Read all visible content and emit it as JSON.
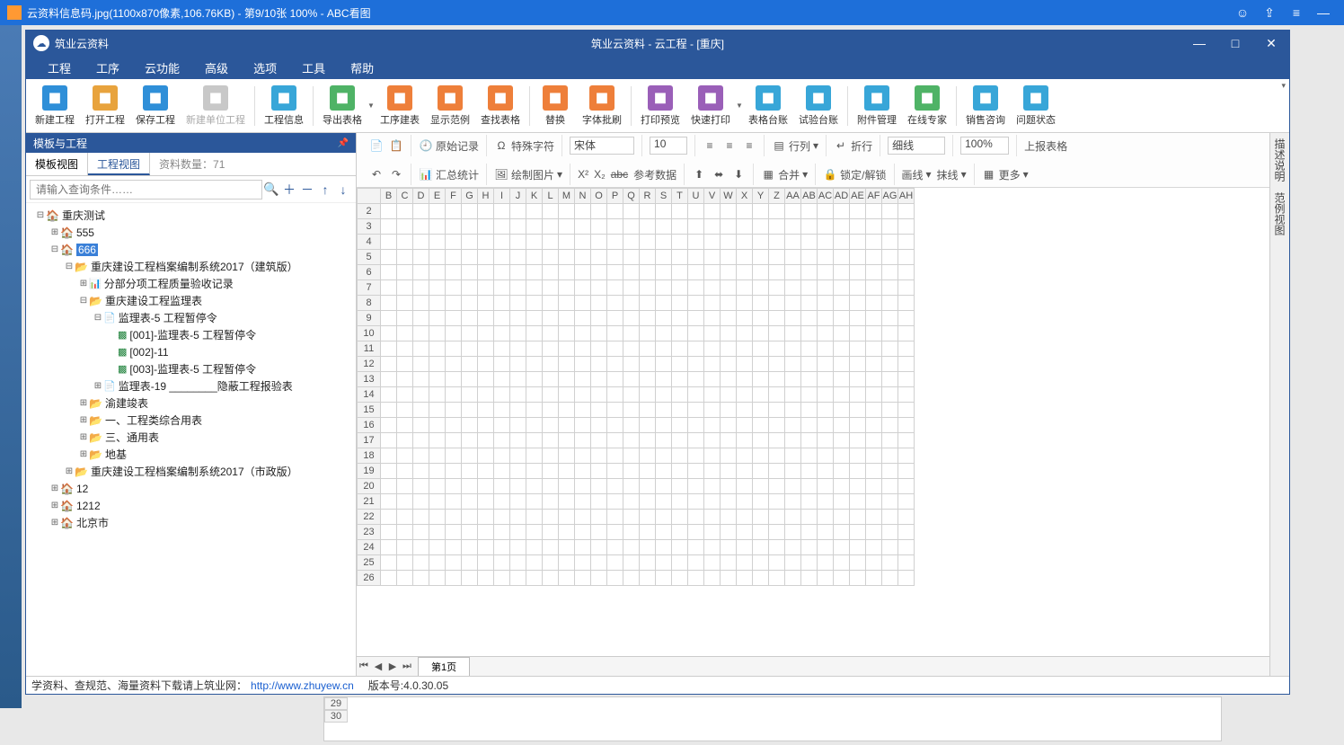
{
  "viewer": {
    "title": "云资料信息码.jpg(1100x870像素,106.76KB) - 第9/10张 100% - ABC看图"
  },
  "app": {
    "brand": "筑业云资料",
    "title": "筑业云资料 - 云工程 - [重庆]"
  },
  "menu": [
    "工程",
    "工序",
    "云功能",
    "高级",
    "选项",
    "工具",
    "帮助"
  ],
  "toolbar": [
    {
      "label": "新建工程",
      "color": "#2f8fd8"
    },
    {
      "label": "打开工程",
      "color": "#e8a33d"
    },
    {
      "label": "保存工程",
      "color": "#2f8fd8"
    },
    {
      "label": "新建单位工程",
      "color": "#c8c8c8",
      "disabled": true
    },
    {
      "sep": true
    },
    {
      "label": "工程信息",
      "color": "#38a6d8"
    },
    {
      "sep": true
    },
    {
      "label": "导出表格",
      "color": "#4fb366"
    },
    {
      "dd": true
    },
    {
      "label": "工序建表",
      "color": "#ee7f3a"
    },
    {
      "label": "显示范例",
      "color": "#ee7f3a"
    },
    {
      "label": "查找表格",
      "color": "#ee7f3a"
    },
    {
      "sep": true
    },
    {
      "label": "替换",
      "color": "#ee7f3a"
    },
    {
      "label": "字体批刷",
      "color": "#ee7f3a"
    },
    {
      "sep": true
    },
    {
      "label": "打印预览",
      "color": "#9a5fb8"
    },
    {
      "label": "快速打印",
      "color": "#9a5fb8"
    },
    {
      "dd": true
    },
    {
      "label": "表格台账",
      "color": "#38a6d8"
    },
    {
      "label": "试验台账",
      "color": "#38a6d8"
    },
    {
      "sep": true
    },
    {
      "label": "附件管理",
      "color": "#38a6d8"
    },
    {
      "label": "在线专家",
      "color": "#4fb366"
    },
    {
      "sep": true
    },
    {
      "label": "销售咨询",
      "color": "#38a6d8"
    },
    {
      "label": "问题状态",
      "color": "#38a6d8"
    }
  ],
  "side": {
    "header": "模板与工程",
    "tabs": {
      "t1": "模板视图",
      "t2": "工程视图",
      "info": "资料数量：71"
    },
    "search_ph": "请输入查询条件……",
    "tree": [
      {
        "d": 0,
        "tw": "⊟",
        "ic": "home",
        "label": "重庆测试"
      },
      {
        "d": 1,
        "tw": "⊞",
        "ic": "home",
        "label": "555"
      },
      {
        "d": 1,
        "tw": "⊟",
        "ic": "home",
        "label": "666",
        "sel": true
      },
      {
        "d": 2,
        "tw": "⊟",
        "ic": "fold",
        "label": "重庆建设工程档案编制系统2017（建筑版）"
      },
      {
        "d": 3,
        "tw": "⊞",
        "ic": "bar",
        "label": "分部分项工程质量验收记录"
      },
      {
        "d": 3,
        "tw": "⊟",
        "ic": "fold",
        "label": "重庆建设工程监理表"
      },
      {
        "d": 4,
        "tw": "⊟",
        "ic": "doc",
        "label": "监理表-5 工程暂停令"
      },
      {
        "d": 5,
        "tw": "",
        "ic": "xls",
        "label": "[001]-监理表-5 工程暂停令"
      },
      {
        "d": 5,
        "tw": "",
        "ic": "xls",
        "label": "[002]-11"
      },
      {
        "d": 5,
        "tw": "",
        "ic": "xls",
        "label": "[003]-监理表-5 工程暂停令"
      },
      {
        "d": 4,
        "tw": "⊞",
        "ic": "doc",
        "label": "监理表-19 ________隐蔽工程报验表"
      },
      {
        "d": 3,
        "tw": "⊞",
        "ic": "fold",
        "label": "渝建竣表"
      },
      {
        "d": 3,
        "tw": "⊞",
        "ic": "fold",
        "label": "一、工程类综合用表"
      },
      {
        "d": 3,
        "tw": "⊞",
        "ic": "fold",
        "label": "三、通用表"
      },
      {
        "d": 3,
        "tw": "⊞",
        "ic": "fold",
        "label": "地基"
      },
      {
        "d": 2,
        "tw": "⊞",
        "ic": "fold",
        "label": "重庆建设工程档案编制系统2017（市政版）"
      },
      {
        "d": 1,
        "tw": "⊞",
        "ic": "home",
        "label": "12"
      },
      {
        "d": 1,
        "tw": "⊞",
        "ic": "home",
        "label": "1212"
      },
      {
        "d": 1,
        "tw": "⊞",
        "ic": "home",
        "label": "北京市"
      }
    ]
  },
  "ribbon": {
    "r1": {
      "orig": "原始记录",
      "spec": "特殊字符",
      "font": "宋体",
      "size": "10",
      "row": "行列",
      "wrap": "折行",
      "line": "细线",
      "zoom": "100%",
      "report": "上报表格"
    },
    "r2": {
      "sum": "汇总统计",
      "draw": "绘制图片",
      "sup": "X²",
      "sub": "X₂",
      "strike": "abc",
      "ref": "参考数据",
      "merge": "合并",
      "lock": "锁定/解锁",
      "hline": "画线",
      "eline": "抹线",
      "more": "更多"
    }
  },
  "grid": {
    "cols": [
      "",
      "B",
      "C",
      "D",
      "E",
      "F",
      "G",
      "H",
      "I",
      "J",
      "K",
      "L",
      "M",
      "N",
      "O",
      "P",
      "Q",
      "R",
      "S",
      "T",
      "U",
      "V",
      "W",
      "X",
      "Y",
      "Z",
      "AA",
      "AB",
      "AC",
      "AD",
      "AE",
      "AF",
      "AG",
      "AH"
    ],
    "rows": [
      "2",
      "3",
      "4",
      "5",
      "6",
      "7",
      "8",
      "9",
      "10",
      "11",
      "12",
      "13",
      "14",
      "15",
      "16",
      "17",
      "18",
      "19",
      "20",
      "21",
      "22",
      "23",
      "24",
      "25",
      "26"
    ],
    "page": "第1页"
  },
  "rail": {
    "a": "描述说明",
    "b": "范例视图"
  },
  "status": {
    "text": "学资料、查规范、海量资料下载请上筑业网：",
    "url": "http://www.zhuyew.cn",
    "ver": "版本号:4.0.30.05"
  },
  "remnant": {
    "r1": "29",
    "r2": "30"
  }
}
